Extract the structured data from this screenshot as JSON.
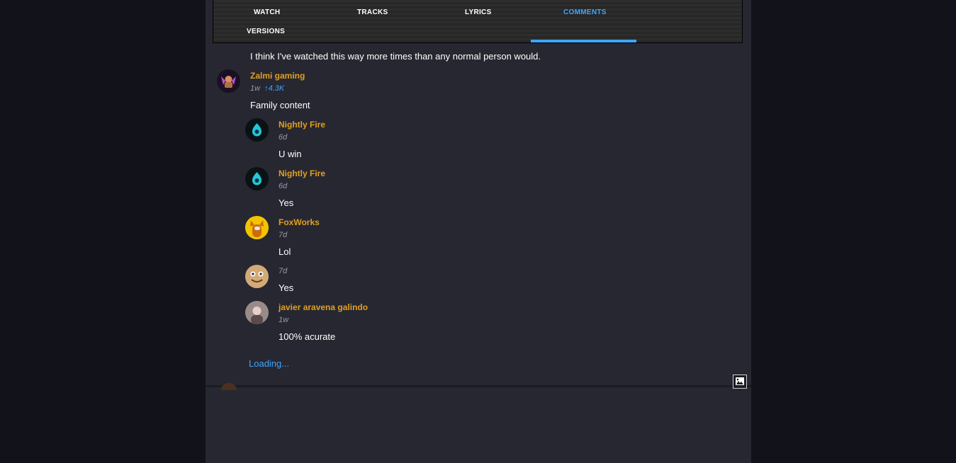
{
  "tabs": [
    {
      "label": "WATCH",
      "active": false
    },
    {
      "label": "TRACKS",
      "active": false
    },
    {
      "label": "LYRICS",
      "active": false
    },
    {
      "label": "COMMENTS",
      "active": true
    },
    {
      "label": "VERSIONS",
      "active": false
    }
  ],
  "previous_comment": {
    "text": "I think I've watched this way more times than any normal person would."
  },
  "comment": {
    "author": "Zalmi gaming",
    "time": "1w",
    "likes": "↑4.3K",
    "text": "Family content"
  },
  "replies": [
    {
      "author": "Nightly Fire",
      "time": "6d",
      "text": "U win"
    },
    {
      "author": "Nightly Fire",
      "time": "6d",
      "text": "Yes"
    },
    {
      "author": "FoxWorks",
      "time": "7d",
      "text": "Lol"
    },
    {
      "author": "ִ",
      "time": "7d",
      "text": "Yes"
    },
    {
      "author": "javier aravena galindo",
      "time": "1w",
      "text": "100% acurate"
    }
  ],
  "loading_label": "Loading...",
  "colors": {
    "accent": "#3ea6ff",
    "author": "#e0a020",
    "panel": "#272731",
    "page": "#12121b"
  }
}
